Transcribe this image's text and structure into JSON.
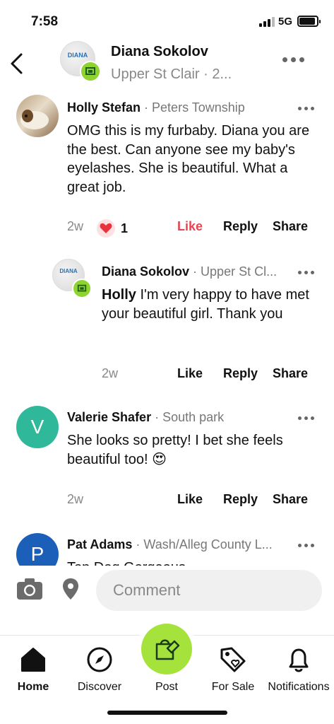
{
  "status_bar": {
    "time": "7:58",
    "network": "5G"
  },
  "header": {
    "name": "Diana Sokolov",
    "subtitle": "Upper St Clair · 2...",
    "avatar_logo_text": "DIANA"
  },
  "comments": [
    {
      "author": "Holly Stefan",
      "location": "· Peters Township",
      "text": "OMG this is my furbaby.  Diana you are the best.  Can anyone see my baby's eyelashes.  She is beautiful.  What a great job.",
      "time": "2w",
      "reaction_count": "1",
      "like_label": "Like",
      "reply_label": "Reply",
      "share_label": "Share"
    },
    {
      "author": "Diana Sokolov",
      "location": "· Upper St Cl...",
      "mention": "Holly",
      "text": " I'm very happy to have met your beautiful girl. Thank you",
      "time": "2w",
      "like_label": "Like",
      "reply_label": "Reply",
      "share_label": "Share"
    },
    {
      "author": "Valerie Shafer",
      "location": "· South park",
      "avatar_initial": "V",
      "text": "She looks so pretty!  I bet she feels beautiful too! 😍",
      "time": "2w",
      "like_label": "Like",
      "reply_label": "Reply",
      "share_label": "Share"
    },
    {
      "author": "Pat Adams",
      "location": "· Wash/Alleg County L...",
      "avatar_initial": "P",
      "text": "Top Dog Gorgeous"
    }
  ],
  "composer": {
    "placeholder": "Comment"
  },
  "nav": [
    {
      "label": "Home",
      "icon": "home-icon"
    },
    {
      "label": "Discover",
      "icon": "compass-icon"
    },
    {
      "label": "Post",
      "icon": "post-bag-icon"
    },
    {
      "label": "For Sale",
      "icon": "price-tag-icon"
    },
    {
      "label": "Notifications",
      "icon": "bell-icon"
    }
  ],
  "colors": {
    "accent_green": "#a6e23c",
    "like_red": "#e64553",
    "valerie_avatar": "#2fb99a",
    "pat_avatar": "#1c5fb8"
  }
}
